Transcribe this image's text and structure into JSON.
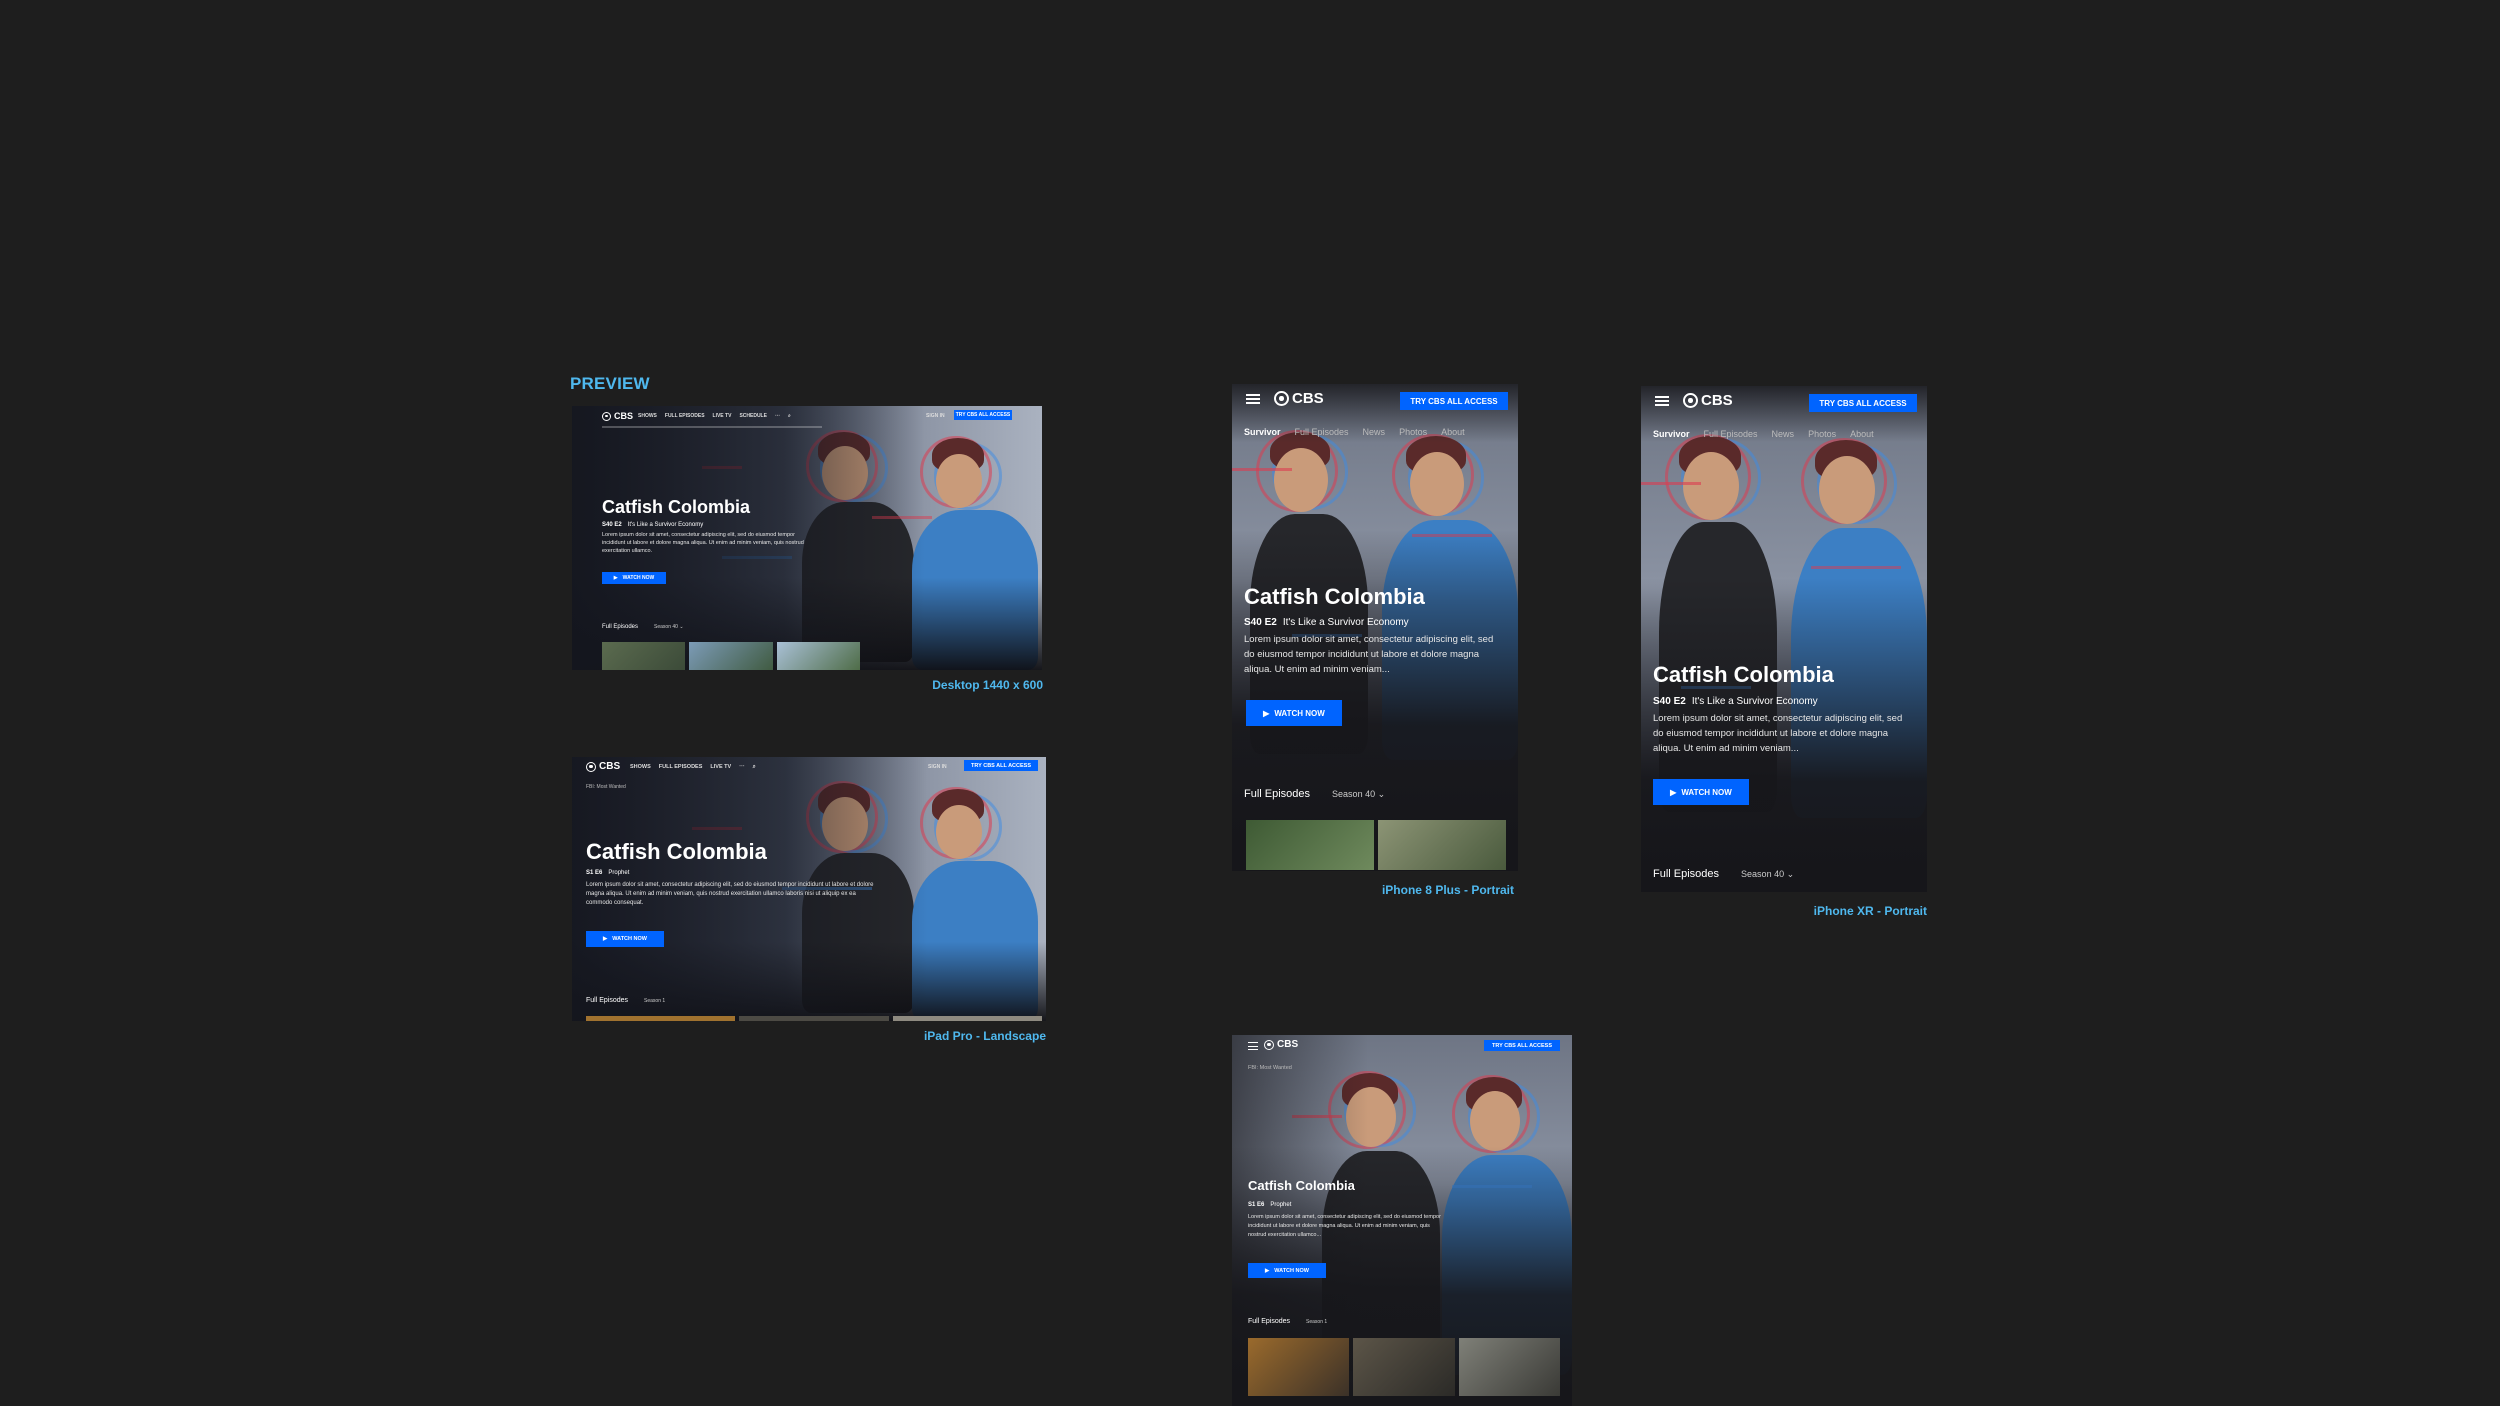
{
  "preview_label": "PREVIEW",
  "colors": {
    "background": "#1e1e1e",
    "caption": "#4fb8ee",
    "cta": "#0064ff"
  },
  "icons": [
    "hamburger-menu-icon",
    "cbs-eye-logo-icon",
    "play-icon",
    "chevron-down-icon",
    "search-icon",
    "more-icon"
  ],
  "desktop": {
    "caption": "Desktop 1440 x 600",
    "logo": "CBS",
    "nav": [
      "SHOWS",
      "FULL EPISODES",
      "LIVE TV",
      "SCHEDULE"
    ],
    "sign_in": "SIGN IN",
    "cta": "TRY CBS ALL ACCESS",
    "title": "Catfish Colombia",
    "episode_code": "S40 E2",
    "episode_title": "It's Like a Survivor Economy",
    "description": "Lorem ipsum dolor sit amet, consectetur adipiscing elit, sed do eiusmod tempor incididunt ut labore et dolore magna aliqua. Ut enim ad minim veniam, quis nostrud exercitation ullamco.",
    "watch": "WATCH NOW",
    "episodes_label": "Full Episodes",
    "season": "Season 40"
  },
  "ipad": {
    "caption": "iPad Pro - Landscape",
    "logo": "CBS",
    "nav": [
      "SHOWS",
      "FULL EPISODES",
      "LIVE TV"
    ],
    "sign_in": "SIGN IN",
    "cta": "TRY CBS ALL ACCESS",
    "subnav_show": "FBI: Most Wanted",
    "title": "Catfish Colombia",
    "episode_code": "S1 E6",
    "episode_title": "Prophet",
    "description": "Lorem ipsum dolor sit amet, consectetur adipiscing elit, sed do eiusmod tempor incididunt ut labore et dolore magna aliqua. Ut enim ad minim veniam, quis nostrud exercitation ullamco laboris nisi ut aliquip ex ea commodo consequat.",
    "watch": "WATCH NOW",
    "episodes_label": "Full Episodes",
    "season": "Season 1"
  },
  "iphone8": {
    "caption": "iPhone 8 Plus - Portrait",
    "logo": "CBS",
    "cta": "TRY CBS ALL ACCESS",
    "tabs": [
      "Survivor",
      "Full Episodes",
      "News",
      "Photos",
      "About"
    ],
    "title": "Catfish Colombia",
    "episode_code": "S40 E2",
    "episode_title": "It's Like a Survivor Economy",
    "description": "Lorem ipsum dolor sit amet, consectetur adipiscing elit, sed do eiusmod tempor incididunt ut labore et dolore magna aliqua. Ut enim ad minim veniam...",
    "watch": "WATCH NOW",
    "episodes_label": "Full Episodes",
    "season": "Season 40"
  },
  "iphonexr": {
    "caption": "iPhone XR - Portrait",
    "logo": "CBS",
    "cta": "TRY CBS ALL ACCESS",
    "tabs": [
      "Survivor",
      "Full Episodes",
      "News",
      "Photos",
      "About"
    ],
    "title": "Catfish Colombia",
    "episode_code": "S40 E2",
    "episode_title": "It's Like a Survivor Economy",
    "description": "Lorem ipsum dolor sit amet, consectetur adipiscing elit, sed do eiusmod tempor incididunt ut labore et dolore magna aliqua. Ut enim ad minim veniam...",
    "watch": "WATCH NOW",
    "episodes_label": "Full Episodes",
    "season": "Season 40"
  },
  "ipad_portrait": {
    "logo": "CBS",
    "cta": "TRY CBS ALL ACCESS",
    "subnav_show": "FBI: Most Wanted",
    "title": "Catfish Colombia",
    "episode_code": "S1 E6",
    "episode_title": "Prophet",
    "description": "Lorem ipsum dolor sit amet, consectetur adipiscing elit, sed do eiusmod tempor incididunt ut labore et dolore magna aliqua. Ut enim ad minim veniam, quis nostrud exercitation ullamco...",
    "watch": "WATCH NOW",
    "episodes_label": "Full Episodes",
    "season": "Season 1"
  }
}
